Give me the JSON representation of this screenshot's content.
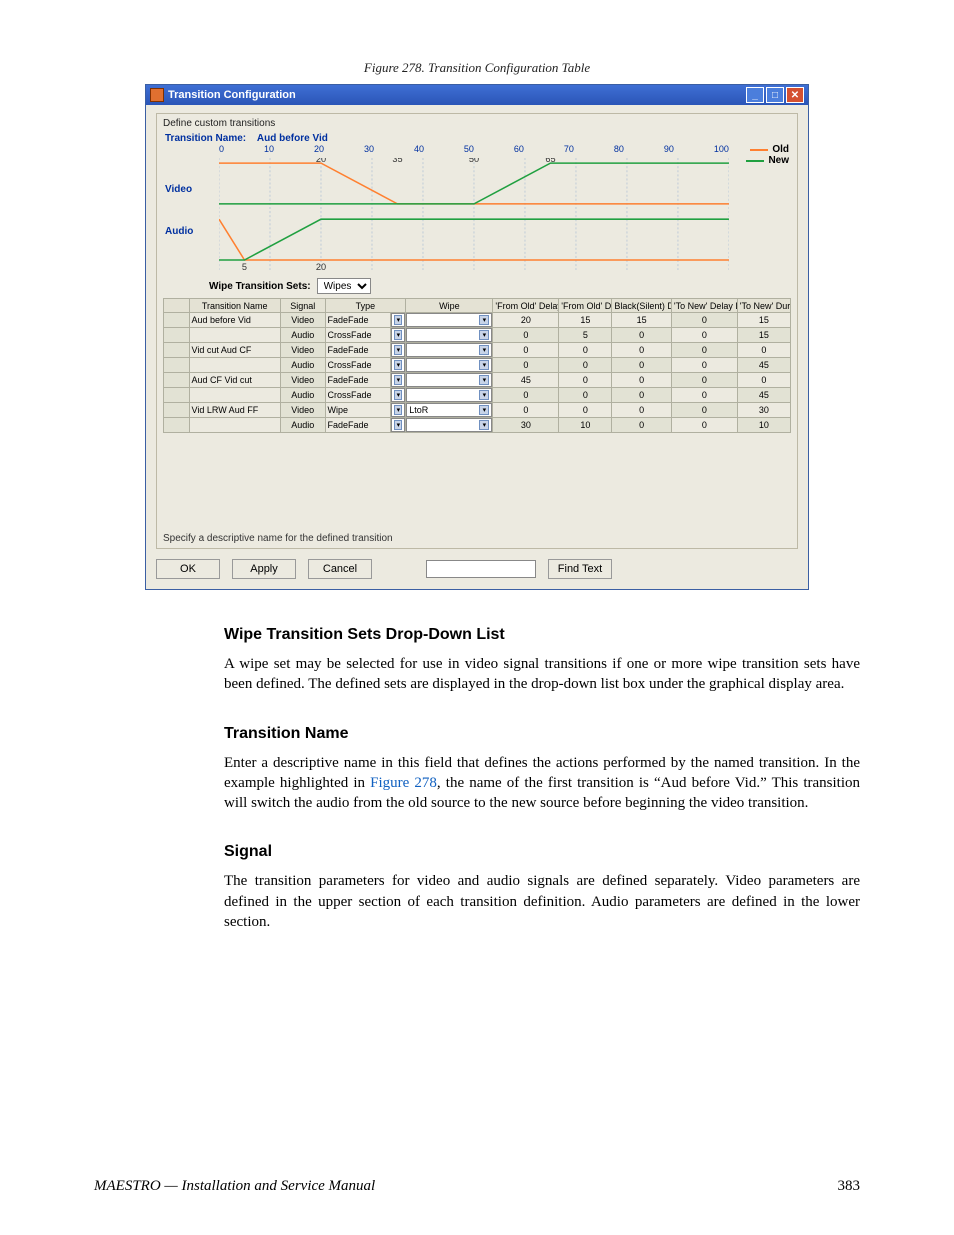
{
  "figure_caption": "Figure 278.  Transition Configuration Table",
  "window": {
    "title": "Transition Configuration",
    "panel_label": "Define custom transitions",
    "transition_name_label": "Transition Name:",
    "transition_name_value": "Aud before Vid",
    "legend_old": "Old",
    "legend_new": "New",
    "video_label": "Video",
    "audio_label": "Audio",
    "wipe_sets_label": "Wipe Transition Sets:",
    "wipe_sets_value": "Wipes",
    "hint": "Specify a descriptive name for the defined transition",
    "ok": "OK",
    "apply": "Apply",
    "cancel": "Cancel",
    "find": "Find Text"
  },
  "axis": {
    "top": [
      "0",
      "10",
      "20",
      "30",
      "40",
      "50",
      "60",
      "70",
      "80",
      "90",
      "100"
    ],
    "video_marks": {
      "a": "20",
      "b": "35",
      "c": "50",
      "d": "65"
    },
    "audio_marks": {
      "a": "5",
      "b": "20"
    }
  },
  "table": {
    "headers": [
      "Transition Name",
      "Signal",
      "Type",
      "",
      "Wipe",
      "'From Old' Delay Duration",
      "'From Old' Duration",
      "Black(Silent) Duration",
      "'To New' Delay Duration",
      "'To New' Duration"
    ],
    "rows": [
      {
        "name": "Aud before Vid",
        "sig": "Video",
        "type": "FadeFade",
        "wipe": "",
        "fodd": "20",
        "fod": "15",
        "bs": "15",
        "tndd": "0",
        "tnd": "15"
      },
      {
        "name": "",
        "sig": "Audio",
        "type": "CrossFade",
        "wipe": "",
        "fodd": "0",
        "fod": "5",
        "bs": "0",
        "tndd": "0",
        "tnd": "15"
      },
      {
        "name": "Vid cut Aud CF",
        "sig": "Video",
        "type": "FadeFade",
        "wipe": "",
        "fodd": "0",
        "fod": "0",
        "bs": "0",
        "tndd": "0",
        "tnd": "0"
      },
      {
        "name": "",
        "sig": "Audio",
        "type": "CrossFade",
        "wipe": "",
        "fodd": "0",
        "fod": "0",
        "bs": "0",
        "tndd": "0",
        "tnd": "45"
      },
      {
        "name": "Aud CF Vid cut",
        "sig": "Video",
        "type": "FadeFade",
        "wipe": "",
        "fodd": "45",
        "fod": "0",
        "bs": "0",
        "tndd": "0",
        "tnd": "0"
      },
      {
        "name": "",
        "sig": "Audio",
        "type": "CrossFade",
        "wipe": "",
        "fodd": "0",
        "fod": "0",
        "bs": "0",
        "tndd": "0",
        "tnd": "45"
      },
      {
        "name": "Vid LRW Aud FF",
        "sig": "Video",
        "type": "Wipe",
        "wipe": "LtoR",
        "fodd": "0",
        "fod": "0",
        "bs": "0",
        "tndd": "0",
        "tnd": "30"
      },
      {
        "name": "",
        "sig": "Audio",
        "type": "FadeFade",
        "wipe": "",
        "fodd": "30",
        "fod": "10",
        "bs": "0",
        "tndd": "0",
        "tnd": "10"
      }
    ]
  },
  "sections": {
    "s1_title": "Wipe Transition Sets Drop-Down List",
    "s1_body": "A wipe set may be selected for use in video signal transitions if one or more wipe transition sets have been defined. The defined sets are displayed in the drop-down list box under the graphical display area.",
    "s2_title": "Transition Name",
    "s2a": "Enter a descriptive name in this field that defines the actions performed by the named transition. In the example highlighted in ",
    "s2_link": "Figure 278",
    "s2b": ", the name of the first transition is “Aud before Vid.” This transition will switch the audio from the old source to the new source before beginning the video transition.",
    "s3_title": "Signal",
    "s3_body": "The transition parameters for video and audio signals are defined separately. Video parameters are defined in the upper section of each transition definition. Audio parameters are defined in the lower section."
  },
  "footer": {
    "left": "MAESTRO  —  Installation and Service Manual",
    "page": "383"
  },
  "chart_data": {
    "type": "line",
    "xlabel": "",
    "ylabel": "",
    "xlim": [
      0,
      100
    ],
    "series_groups": [
      {
        "name": "Video",
        "old": [
          [
            0,
            1
          ],
          [
            20,
            1
          ],
          [
            35,
            0
          ],
          [
            100,
            0
          ]
        ],
        "new": [
          [
            0,
            0
          ],
          [
            50,
            0
          ],
          [
            65,
            1
          ],
          [
            100,
            1
          ]
        ]
      },
      {
        "name": "Audio",
        "old": [
          [
            0,
            1
          ],
          [
            0,
            1
          ],
          [
            5,
            0
          ],
          [
            100,
            0
          ]
        ],
        "new": [
          [
            0,
            0
          ],
          [
            5,
            0
          ],
          [
            20,
            1
          ],
          [
            100,
            1
          ]
        ]
      }
    ],
    "legend": [
      "Old",
      "New"
    ]
  }
}
